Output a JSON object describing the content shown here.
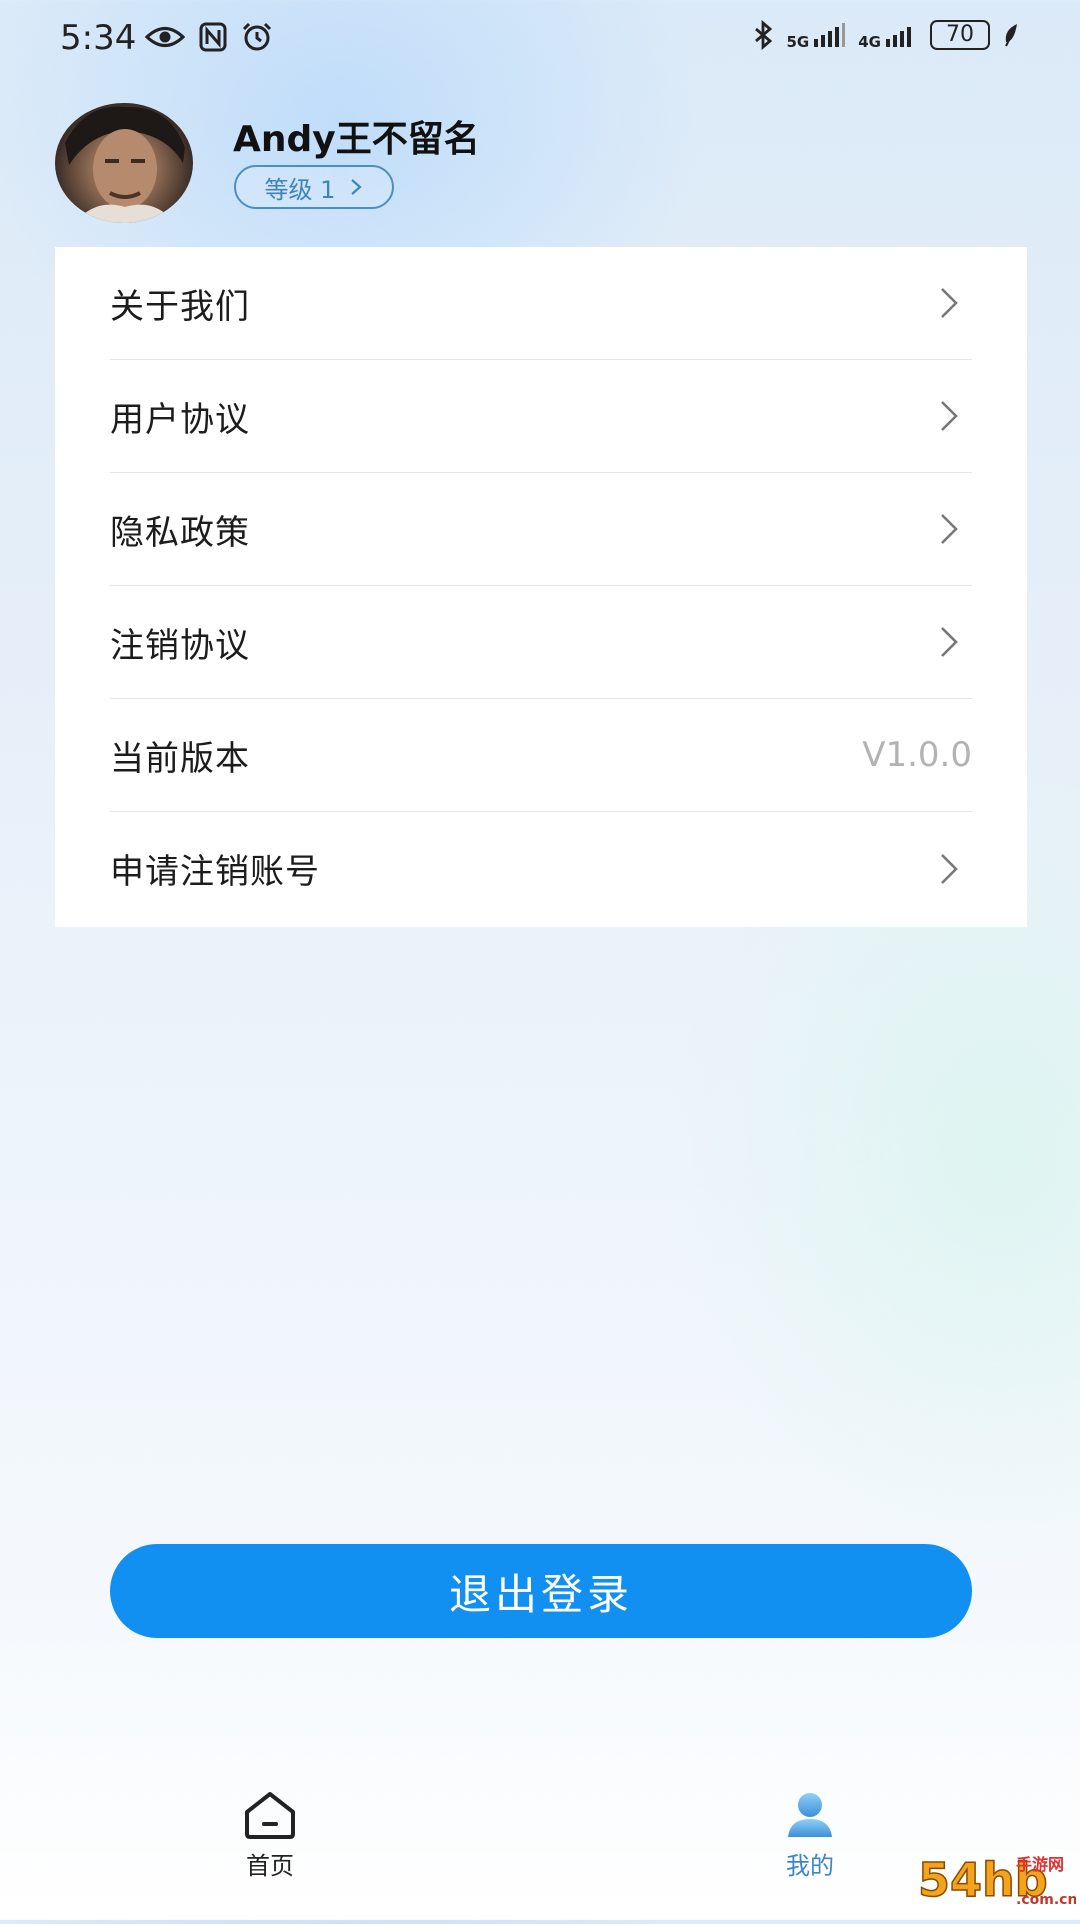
{
  "status_bar": {
    "time": "5:34",
    "net_5g": "5G",
    "net_4g": "4G",
    "battery": "70"
  },
  "profile": {
    "username": "Andy王不留名",
    "level": "等级 1"
  },
  "menu": {
    "items": [
      {
        "label": "关于我们"
      },
      {
        "label": "用户协议"
      },
      {
        "label": "隐私政策"
      },
      {
        "label": "注销协议"
      },
      {
        "label": "当前版本",
        "value": "V1.0.0"
      },
      {
        "label": "申请注销账号"
      }
    ]
  },
  "logout": {
    "label": "退出登录"
  },
  "tabbar": {
    "home_label": "首页",
    "mine_label": "我的"
  },
  "watermark": {
    "text": "54hb手游网",
    "url": ".com.cn"
  },
  "colors": {
    "accent": "#1290f2",
    "active_tab": "#3d86c6",
    "level_badge": "#3d85b8"
  }
}
